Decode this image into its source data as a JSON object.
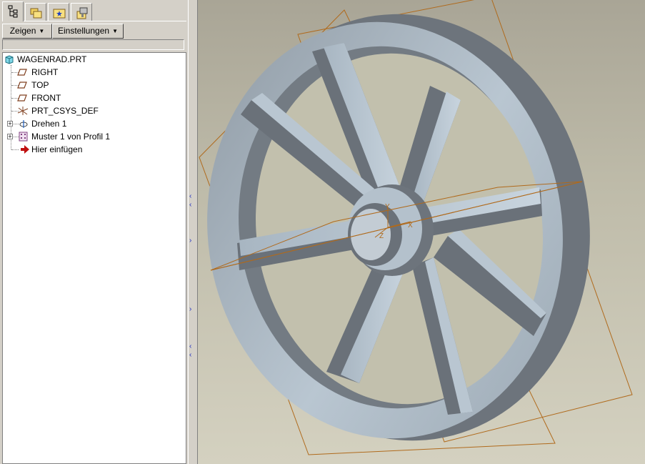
{
  "tabs": [
    {
      "name": "model-tree-tab",
      "icon": "model-tree-icon",
      "active": true
    },
    {
      "name": "folder-browser-tab",
      "icon": "folder-browser-icon",
      "active": false
    },
    {
      "name": "favorites-tab",
      "icon": "favorites-folder-icon",
      "active": false
    },
    {
      "name": "connections-tab",
      "icon": "connections-icon",
      "active": false
    }
  ],
  "toolbar": {
    "show_label": "Zeigen",
    "settings_label": "Einstellungen"
  },
  "tree": {
    "root": {
      "label": "WAGENRAD.PRT",
      "icon": "part-icon"
    },
    "items": [
      {
        "label": "RIGHT",
        "icon": "datum-plane-icon",
        "expandable": false
      },
      {
        "label": "TOP",
        "icon": "datum-plane-icon",
        "expandable": false
      },
      {
        "label": "FRONT",
        "icon": "datum-plane-icon",
        "expandable": false
      },
      {
        "label": "PRT_CSYS_DEF",
        "icon": "coordinate-system-icon",
        "expandable": false
      },
      {
        "label": "Drehen 1",
        "icon": "revolve-icon",
        "expandable": true
      },
      {
        "label": "Muster 1 von Profil 1",
        "icon": "pattern-icon",
        "expandable": true
      },
      {
        "label": "Hier einfügen",
        "icon": "insert-here-arrow-icon",
        "expandable": false
      }
    ]
  },
  "viewport": {
    "model_name": "WAGENRAD.PRT",
    "csys_labels": {
      "y": "Y",
      "z": "Z",
      "x": "X"
    },
    "colors": {
      "model_surface": "#a9b9c6",
      "model_shadow": "#6c737b",
      "datum_plane": "#b06a1c",
      "background_top": "#a9a596",
      "background_bottom": "#d4d1c0"
    }
  }
}
